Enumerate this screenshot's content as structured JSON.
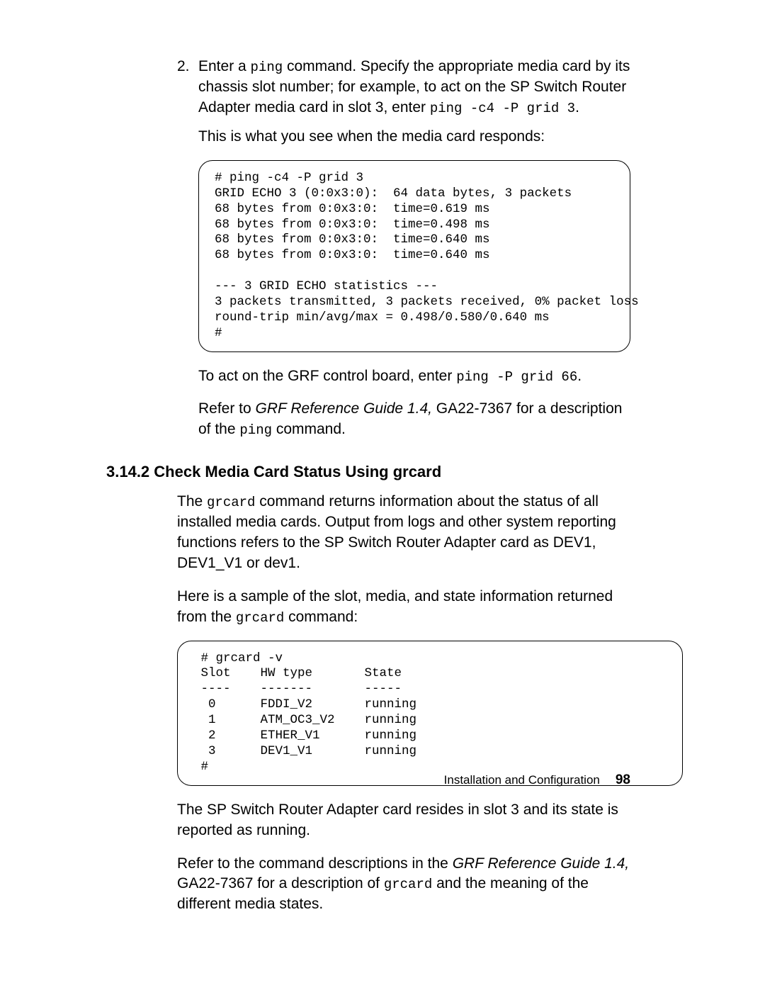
{
  "step2": {
    "marker": "2.",
    "text_before_ping": "Enter a ",
    "ping_cmd": "ping",
    "text_after_ping": " command. Specify the appropriate media card by its chassis slot number; for example, to act on the SP Switch Router Adapter media card in slot 3, enter ",
    "ping_example": "ping -c4 -P grid 3",
    "period": ".",
    "response_intro": "This is what you see when the media card responds:"
  },
  "code1": "# ping -c4 -P grid 3\nGRID ECHO 3 (0:0x3:0):  64 data bytes, 3 packets\n68 bytes from 0:0x3:0:  time=0.619 ms\n68 bytes from 0:0x3:0:  time=0.498 ms\n68 bytes from 0:0x3:0:  time=0.640 ms\n68 bytes from 0:0x3:0:  time=0.640 ms\n\n--- 3 GRID ECHO statistics ---\n3 packets transmitted, 3 packets received, 0% packet loss\nround-trip min/avg/max = 0.498/0.580/0.640 ms\n#",
  "after_code1": {
    "line1_a": "To act on the GRF control board, enter ",
    "line1_cmd": "ping -P grid 66",
    "line1_b": ".",
    "line2_a": "Refer to ",
    "line2_italic": "GRF Reference Guide 1.4,",
    "line2_b": " GA22-7367 for a description of the ",
    "line2_cmd": "ping",
    "line2_c": " command."
  },
  "heading": "3.14.2  Check Media Card Status Using grcard",
  "grcard_para1_a": "The ",
  "grcard_para1_cmd": "grcard",
  "grcard_para1_b": " command returns information about the status of all installed media cards. Output from logs and other system reporting functions refers to the SP Switch Router Adapter card as DEV1, DEV1_V1 or dev1.",
  "grcard_para2_a": "Here is a sample of the slot, media, and state information returned from the ",
  "grcard_para2_cmd": "grcard",
  "grcard_para2_b": " command:",
  "code2": " # grcard -v\n Slot    HW type       State\n ----    -------       -----\n  0      FDDI_V2       running\n  1      ATM_OC3_V2    running\n  2      ETHER_V1      running\n  3      DEV1_V1       running\n #",
  "grcard_para3": "The SP Switch Router Adapter card resides in slot 3 and its state is reported as running.",
  "grcard_para4_a": "Refer to the command descriptions in the ",
  "grcard_para4_italic": "GRF Reference Guide 1.4,",
  "grcard_para4_b": " GA22-7367 for a description of ",
  "grcard_para4_cmd": "grcard",
  "grcard_para4_c": " and the meaning of the different media states.",
  "footer_text": "Installation and Configuration",
  "footer_page": "98"
}
